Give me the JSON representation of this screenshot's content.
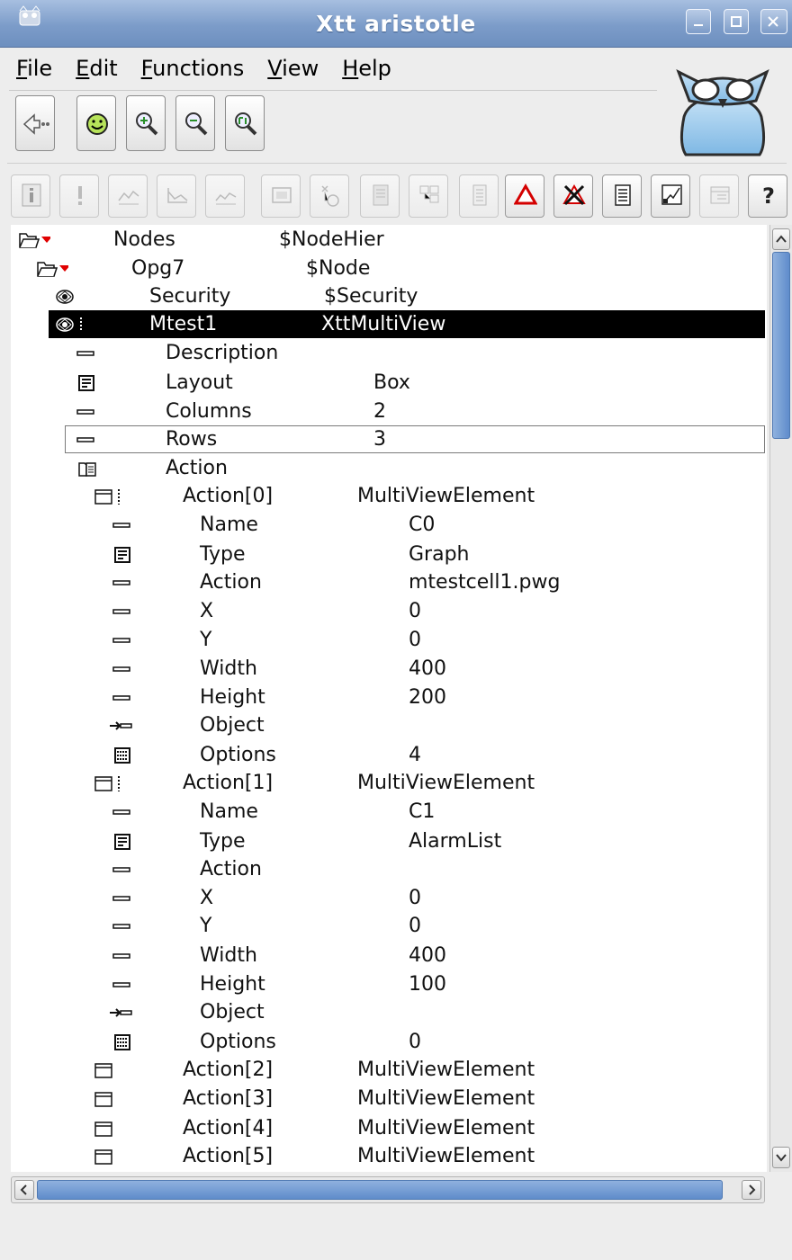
{
  "window": {
    "title": "Xtt aristotle"
  },
  "menu": [
    {
      "pre": "",
      "mnemonic": "F",
      "post": "ile"
    },
    {
      "pre": "",
      "mnemonic": "E",
      "post": "dit"
    },
    {
      "pre": "",
      "mnemonic": "F",
      "post": "unctions"
    },
    {
      "pre": "",
      "mnemonic": "V",
      "post": "iew"
    },
    {
      "pre": "",
      "mnemonic": "H",
      "post": "elp"
    }
  ],
  "tree": [
    {
      "name": "Nodes",
      "value": "$NodeHier"
    },
    {
      "name": "Opg7",
      "value": "$Node"
    },
    {
      "name": "Security",
      "value": "$Security"
    },
    {
      "name": "Mtest1",
      "value": "XttMultiView"
    },
    {
      "name": "Description",
      "value": ""
    },
    {
      "name": "Layout",
      "value": "Box"
    },
    {
      "name": "Columns",
      "value": "2"
    },
    {
      "name": "Rows",
      "value": "3"
    },
    {
      "name": "Action",
      "value": ""
    },
    {
      "name": "Action[0]",
      "value": "MultiViewElement"
    },
    {
      "name": "Name",
      "value": "C0"
    },
    {
      "name": "Type",
      "value": "Graph"
    },
    {
      "name": "Action",
      "value": "mtestcell1.pwg"
    },
    {
      "name": "X",
      "value": "0"
    },
    {
      "name": "Y",
      "value": "0"
    },
    {
      "name": "Width",
      "value": "400"
    },
    {
      "name": "Height",
      "value": "200"
    },
    {
      "name": "Object",
      "value": ""
    },
    {
      "name": "Options",
      "value": "4"
    },
    {
      "name": "Action[1]",
      "value": "MultiViewElement"
    },
    {
      "name": "Name",
      "value": "C1"
    },
    {
      "name": "Type",
      "value": "AlarmList"
    },
    {
      "name": "Action",
      "value": ""
    },
    {
      "name": "X",
      "value": "0"
    },
    {
      "name": "Y",
      "value": "0"
    },
    {
      "name": "Width",
      "value": "400"
    },
    {
      "name": "Height",
      "value": "100"
    },
    {
      "name": "Object",
      "value": ""
    },
    {
      "name": "Options",
      "value": "0"
    },
    {
      "name": "Action[2]",
      "value": "MultiViewElement"
    },
    {
      "name": "Action[3]",
      "value": "MultiViewElement"
    },
    {
      "name": "Action[4]",
      "value": "MultiViewElement"
    },
    {
      "name": "Action[5]",
      "value": "MultiViewElement"
    }
  ],
  "icons": {
    "toolbar1": [
      "back-arrow-icon",
      "smiley-icon",
      "zoom-in-icon",
      "zoom-out-icon",
      "zoom-reset-icon"
    ],
    "toolbar2": [
      "info-icon",
      "exclamation-icon",
      "trend-icon",
      "fast-icon",
      "history-icon",
      "graph-icon",
      "open-plc-icon",
      "crossref-icon",
      "class-graph-icon",
      "documentation-icon",
      "alarm-block-icon",
      "alarm-unblock-icon",
      "object-icon",
      "plot-icon",
      "options-icon",
      "help-icon"
    ]
  },
  "colors": {
    "selection": "#000000",
    "expand_arrow": "#e00000",
    "titlebar": "#7c9cc9"
  }
}
